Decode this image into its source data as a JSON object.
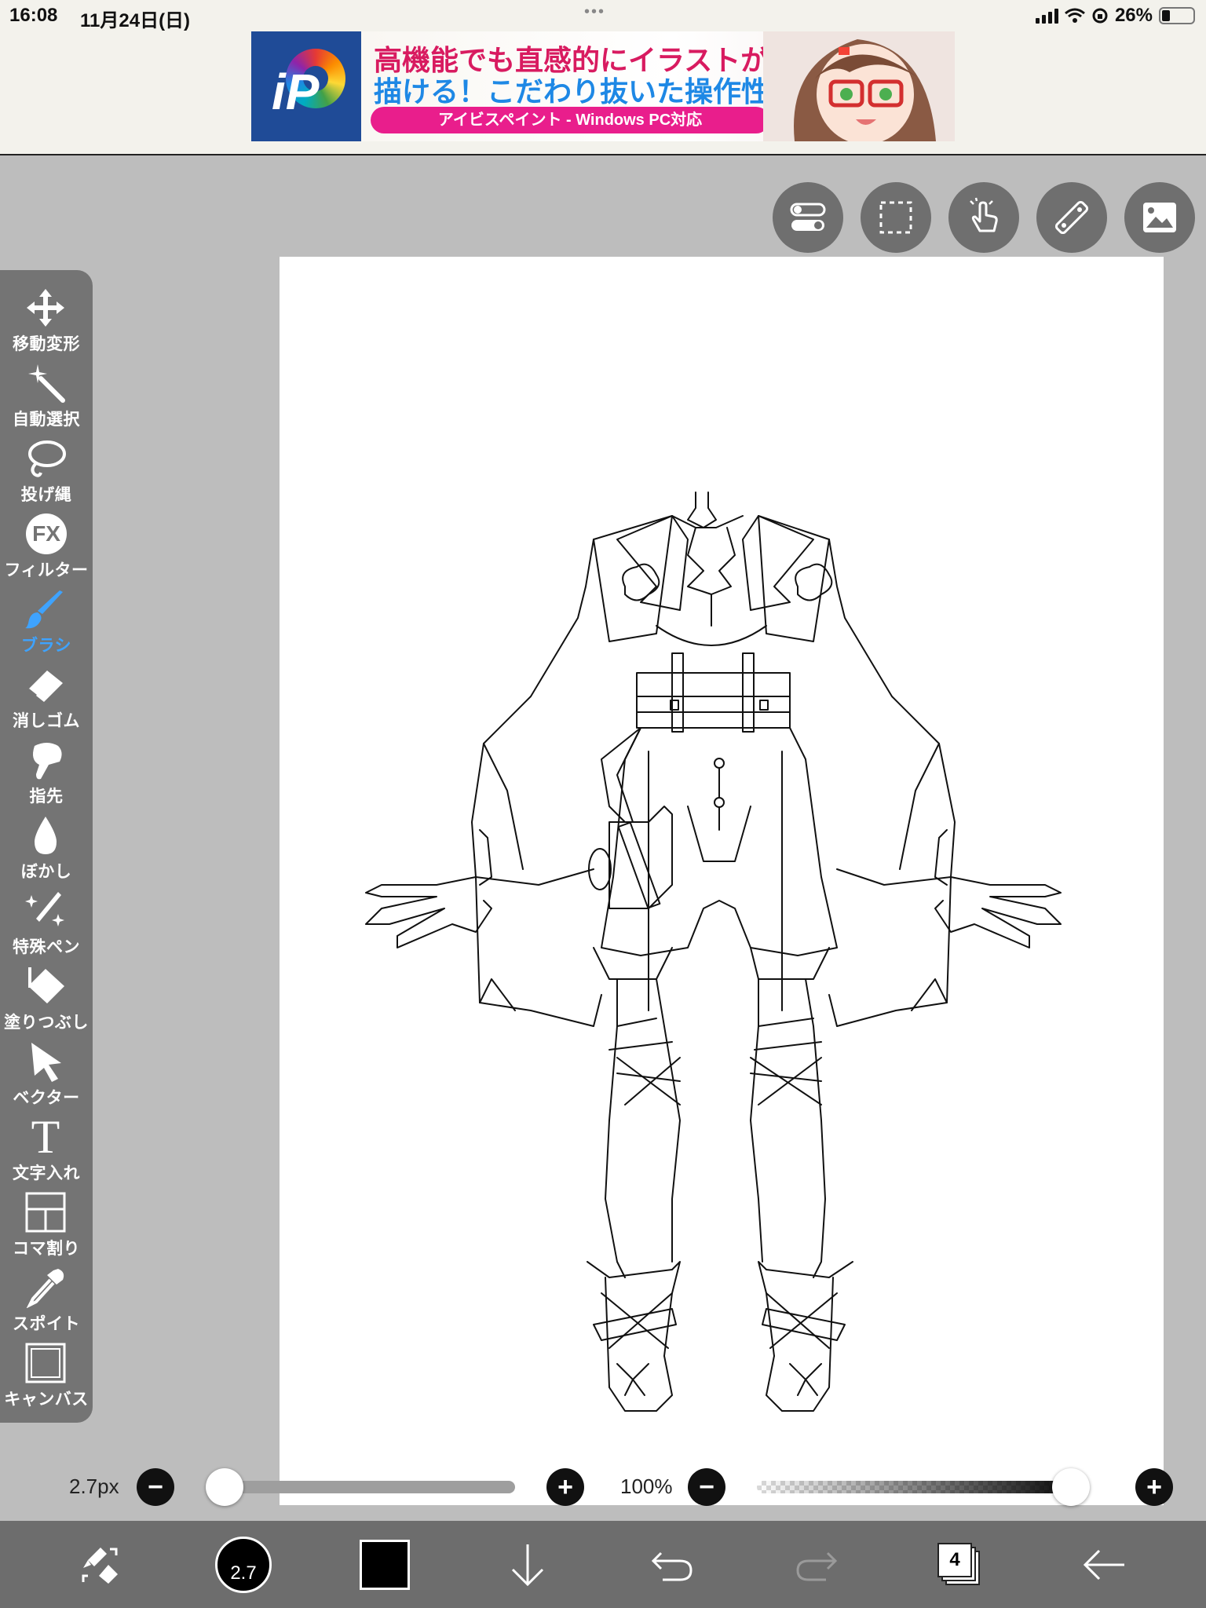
{
  "status_bar": {
    "time": "16:08",
    "date": "11月24日(日)",
    "dots": "•••",
    "battery": "26%"
  },
  "ad": {
    "line1": "高機能でも直感的にイラストが",
    "line2": "描ける！こだわり抜いた操作性！",
    "pill": "アイビスペイント - Windows PC対応",
    "logo_text": "iP"
  },
  "top_tools": [
    {
      "name": "toggle-icon"
    },
    {
      "name": "selection-icon"
    },
    {
      "name": "touch-icon"
    },
    {
      "name": "ruler-icon"
    },
    {
      "name": "image-icon"
    }
  ],
  "tools": [
    {
      "label": "移動変形",
      "icon": "move-icon",
      "active": false
    },
    {
      "label": "自動選択",
      "icon": "magic-wand-icon",
      "active": false
    },
    {
      "label": "投げ縄",
      "icon": "lasso-icon",
      "active": false
    },
    {
      "label": "フィルター",
      "icon": "fx-icon",
      "active": false,
      "icon_text": "FX"
    },
    {
      "label": "ブラシ",
      "icon": "brush-icon",
      "active": true
    },
    {
      "label": "消しゴム",
      "icon": "eraser-icon",
      "active": false
    },
    {
      "label": "指先",
      "icon": "finger-icon",
      "active": false
    },
    {
      "label": "ぼかし",
      "icon": "blur-drop-icon",
      "active": false
    },
    {
      "label": "特殊ペン",
      "icon": "special-pen-icon",
      "active": false
    },
    {
      "label": "塗りつぶし",
      "icon": "fill-icon",
      "active": false
    },
    {
      "label": "ベクター",
      "icon": "vector-cursor-icon",
      "active": false
    },
    {
      "label": "文字入れ",
      "icon": "text-icon",
      "active": false,
      "icon_text": "T"
    },
    {
      "label": "コマ割り",
      "icon": "frame-divider-icon",
      "active": false
    },
    {
      "label": "スポイト",
      "icon": "eyedropper-icon",
      "active": false
    },
    {
      "label": "キャンバス",
      "icon": "canvas-icon",
      "active": false
    }
  ],
  "brush": {
    "size_label": "2.7px",
    "size_value": 2.7,
    "size_slider_fraction": 0.0,
    "disc_label": "2.7"
  },
  "opacity": {
    "label": "100%",
    "fraction": 1.0
  },
  "colors": {
    "palette_bg": "#747474",
    "active_tool": "#3ea3ff",
    "toolbar_bg": "#6d6d6d",
    "current_color": "#000000"
  },
  "layers": {
    "count": "4"
  },
  "bottom_toolbar": [
    {
      "name": "quick-swap-icon"
    },
    {
      "name": "brush-size-disc"
    },
    {
      "name": "color-swatch"
    },
    {
      "name": "download-arrow-icon"
    },
    {
      "name": "undo-icon"
    },
    {
      "name": "redo-icon"
    },
    {
      "name": "layers-icon"
    },
    {
      "name": "back-arrow-icon"
    }
  ]
}
